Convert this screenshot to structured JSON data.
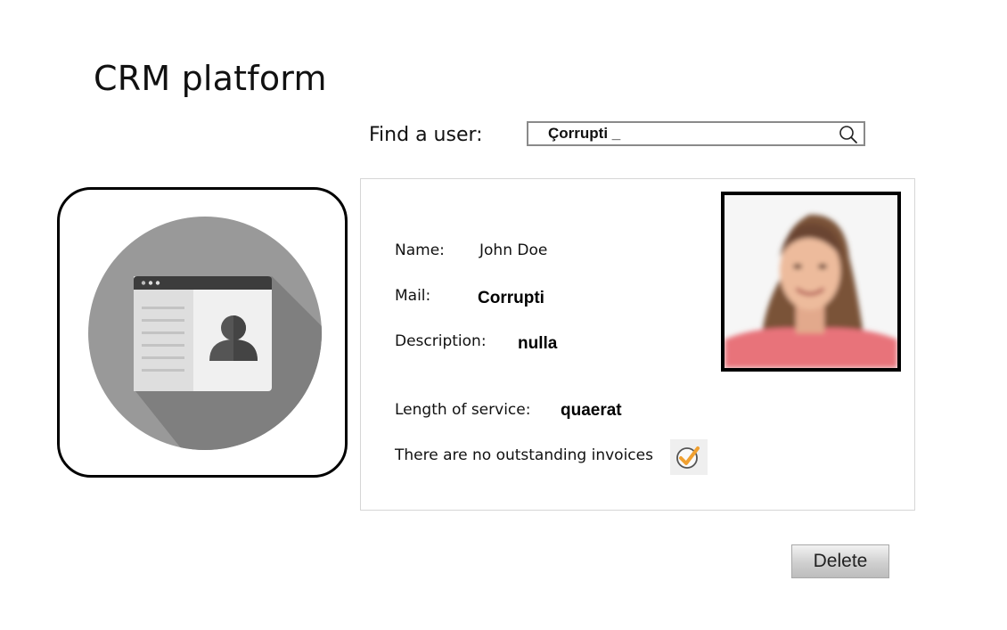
{
  "app": {
    "title": "CRM platform"
  },
  "search": {
    "label": "Find a user:",
    "value": "Çorrupti _",
    "icon": "search-icon"
  },
  "card_icon": "contact-card-icon",
  "user": {
    "name_label": "Name:",
    "name": "John Doe",
    "mail_label": "Mail:",
    "mail": "Corrupti",
    "description_label": "Description:",
    "description": "nulla",
    "service_label": "Length of service:",
    "service": "quaerat",
    "invoices_text": "There are no outstanding invoices",
    "invoices_icon": "checkmark-icon",
    "photo": "user-photo"
  },
  "actions": {
    "delete_label": "Delete"
  },
  "colors": {
    "icon_circle": "#999999",
    "icon_shadow": "#7f7f7f",
    "check_accent": "#f0a030"
  }
}
